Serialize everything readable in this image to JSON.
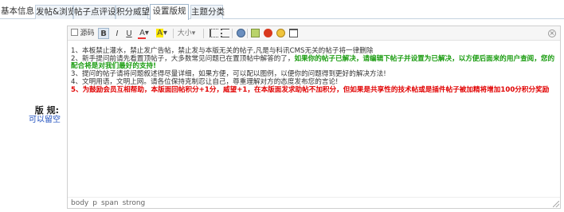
{
  "tabs": [
    {
      "label": "基本信息",
      "active": false
    },
    {
      "label": "发帖&浏览",
      "active": false
    },
    {
      "label": "帖子点评设置",
      "active": false
    },
    {
      "label": "积分威望",
      "active": false
    },
    {
      "label": "设置版规",
      "active": true
    },
    {
      "label": "主题分类",
      "active": false
    }
  ],
  "field": {
    "label": "版 规:",
    "sublabel": "可以留空"
  },
  "toolbar": {
    "source_label": "源码",
    "bold": "B",
    "italic": "I",
    "underline": "U",
    "font_color": "A",
    "highlight": "A",
    "font_size": "大小",
    "dropdown_arrow": "▾",
    "close": "×"
  },
  "content": {
    "line1": "1、本板禁止灌水，禁止发广告帖，禁止发与本版无关的帖子,凡是与科讯CMS无关的帖子将一律删除",
    "line2_normal": "2、新手提问前请先看置顶帖子，大多数常见问题已在置顶帖中解答的了，",
    "line2_green": "如果你的帖子已解决，请编辑下帖子并设置为已解决，以方便后面来的用户查阅，您的配合将是对我们最好的支持!",
    "line3": "3、提问的帖子请将问题叙述得尽量详细，如果方便，可以配以图例，以便你的问题得到更好的解决方法!",
    "line4": "4、文明用语，文明上网。请各位保持克制忍让自己，尊重理解对方的态度发布您的言论!",
    "line5_red": "5、为鼓励会员互相帮助，本版面回帖积分+1分，威望+1，在本版面发求助帖不加积分，但如果是共享性的技术帖或是插件帖子被加精将增加100分积分奖励"
  },
  "statusbar": {
    "path": [
      "body",
      "p",
      "span",
      "strong"
    ]
  },
  "colors": {
    "green_text": "#1a9c10",
    "red_text": "#e10000",
    "tab_border": "#c5d3e0",
    "label_link": "#1f4fbf"
  },
  "icons": [
    "source-icon",
    "ordered-list-icon",
    "unordered-list-icon",
    "link-icon",
    "image-icon",
    "flash-icon",
    "emoticon-icon",
    "table-icon",
    "resize-handle-icon"
  ]
}
